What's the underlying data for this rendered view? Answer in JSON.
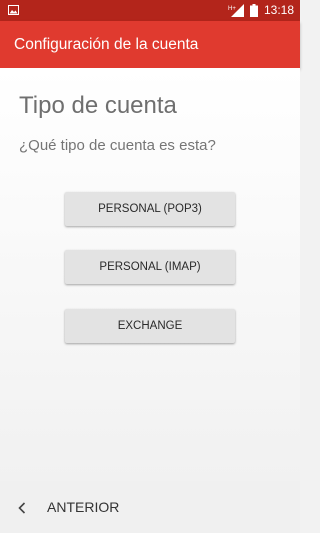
{
  "status_bar": {
    "time": "13:18",
    "network": "H+",
    "icons": [
      "image-notification-icon",
      "signal-icon",
      "battery-icon"
    ]
  },
  "app_bar": {
    "title": "Configuración de la cuenta"
  },
  "main": {
    "heading": "Tipo de cuenta",
    "question": "¿Qué tipo de cuenta es esta?",
    "options": [
      {
        "label": "PERSONAL (POP3)"
      },
      {
        "label": "PERSONAL (IMAP)"
      },
      {
        "label": "EXCHANGE"
      }
    ]
  },
  "footer": {
    "back_label": "ANTERIOR",
    "back_icon": "chevron-left-icon"
  },
  "colors": {
    "status_bar": "#b3251b",
    "app_bar": "#e03a2f",
    "button": "#e3e3e3"
  }
}
